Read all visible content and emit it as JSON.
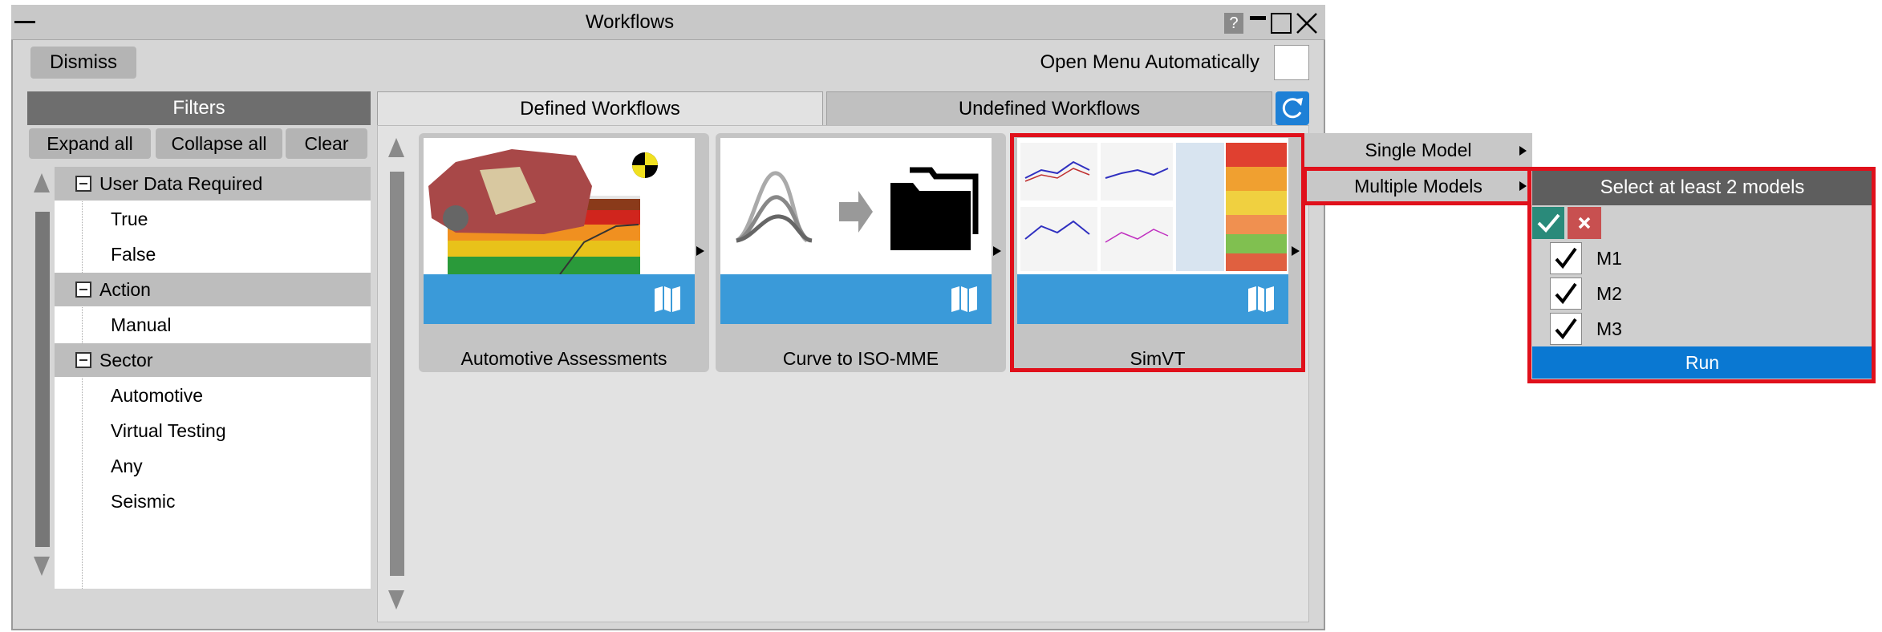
{
  "window": {
    "title": "Workflows"
  },
  "toolbar": {
    "dismiss_label": "Dismiss",
    "open_menu_label": "Open Menu Automatically"
  },
  "filters": {
    "header": "Filters",
    "expand_label": "Expand all",
    "collapse_label": "Collapse all",
    "clear_label": "Clear",
    "groups": [
      {
        "label": "User Data Required",
        "items": [
          "True",
          "False"
        ]
      },
      {
        "label": "Action",
        "items": [
          "Manual"
        ]
      },
      {
        "label": "Sector",
        "items": [
          "Automotive",
          "Virtual Testing",
          "Any",
          "Seismic"
        ]
      }
    ]
  },
  "tabs": {
    "defined": "Defined Workflows",
    "undefined": "Undefined Workflows"
  },
  "workflows": [
    {
      "label": "Automotive Assessments"
    },
    {
      "label": "Curve to ISO-MME"
    },
    {
      "label": "SimVT"
    }
  ],
  "context_menu": {
    "single": "Single Model",
    "multiple": "Multiple Models"
  },
  "model_select": {
    "header": "Select at least 2 models",
    "models": [
      "M1",
      "M2",
      "M3"
    ],
    "run_label": "Run"
  },
  "colors": {
    "accent": "#3a9ad9",
    "highlight": "#e0101b",
    "run": "#0a78d2"
  }
}
